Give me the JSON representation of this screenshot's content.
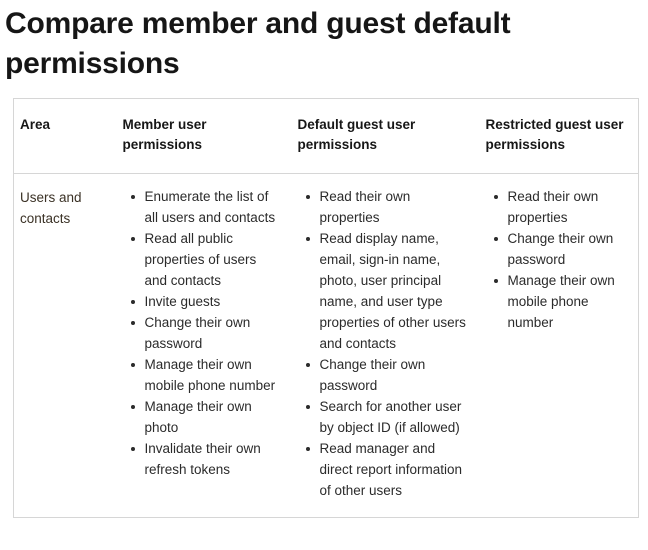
{
  "page": {
    "title": "Compare member and guest default permissions"
  },
  "table": {
    "headers": [
      {
        "label": "Area"
      },
      {
        "label": "Member user permissions"
      },
      {
        "label": "Default guest user permissions"
      },
      {
        "label": "Restricted guest user permissions"
      }
    ],
    "rows": [
      {
        "area": "Users and contacts",
        "member_permissions": [
          "Enumerate the list of all users and contacts",
          "Read all public properties of users and contacts",
          "Invite guests",
          "Change their own password",
          "Manage their own mobile phone number",
          "Manage their own photo",
          "Invalidate their own refresh tokens"
        ],
        "default_guest_permissions": [
          "Read their own properties",
          "Read display name, email, sign-in name, photo, user principal name, and user type properties of other users and contacts",
          "Change their own password",
          "Search for another user by object ID (if allowed)",
          "Read manager and direct report information of other users"
        ],
        "restricted_guest_permissions": [
          "Read their own properties",
          "Change their own password",
          "Manage their own mobile phone number"
        ]
      }
    ]
  },
  "colors": {
    "title_text": "#161616",
    "header_text": "#171717",
    "body_text": "#2b2b2b",
    "area_text": "#3b3226",
    "border": "#d6d6d6",
    "background": "#ffffff"
  }
}
